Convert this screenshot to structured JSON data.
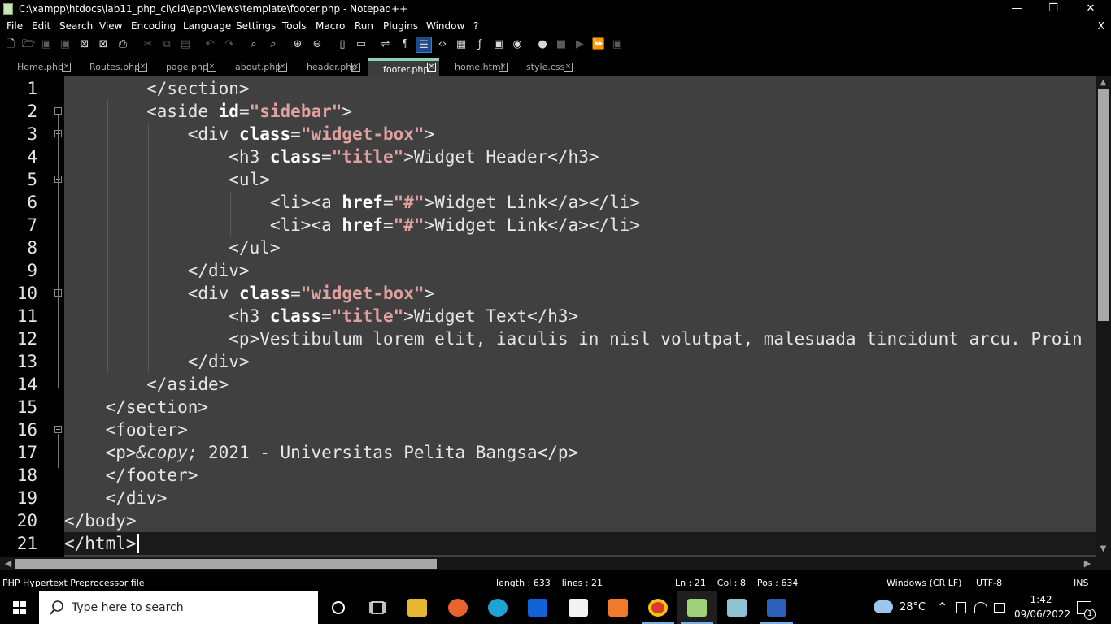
{
  "window": {
    "title": "C:\\xampp\\htdocs\\lab11_php_ci\\ci4\\app\\Views\\template\\footer.php - Notepad++",
    "minimize": "—",
    "maximize": "❐",
    "close": "✕"
  },
  "menu": {
    "items": [
      "File",
      "Edit",
      "Search",
      "View",
      "Encoding",
      "Language",
      "Settings",
      "Tools",
      "Macro",
      "Run",
      "Plugins",
      "Window",
      "?"
    ],
    "close_doc": "X"
  },
  "tabs": [
    {
      "label": "Home.php",
      "active": false
    },
    {
      "label": "Routes.php",
      "active": false
    },
    {
      "label": "page.php",
      "active": false
    },
    {
      "label": "about.php",
      "active": false
    },
    {
      "label": "header.php",
      "active": false
    },
    {
      "label": "footer.php",
      "active": true
    },
    {
      "label": "home.html",
      "active": false
    },
    {
      "label": "style.css",
      "active": false
    }
  ],
  "tab_close_glyph": "×",
  "editor": {
    "line_numbers": [
      "1",
      "2",
      "3",
      "4",
      "5",
      "6",
      "7",
      "8",
      "9",
      "10",
      "11",
      "12",
      "13",
      "14",
      "15",
      "16",
      "17",
      "18",
      "19",
      "20",
      "21"
    ],
    "current_line": 21,
    "lines": [
      [
        {
          "t": "        </section>"
        }
      ],
      [
        {
          "t": "        <aside "
        },
        {
          "t": "id",
          "c": "kw"
        },
        {
          "t": "="
        },
        {
          "t": "\"sidebar\"",
          "c": "str"
        },
        {
          "t": ">"
        }
      ],
      [
        {
          "t": "            <div "
        },
        {
          "t": "class",
          "c": "kw"
        },
        {
          "t": "="
        },
        {
          "t": "\"widget-box\"",
          "c": "str"
        },
        {
          "t": ">"
        }
      ],
      [
        {
          "t": "                <h3 "
        },
        {
          "t": "class",
          "c": "kw"
        },
        {
          "t": "="
        },
        {
          "t": "\"title\"",
          "c": "str"
        },
        {
          "t": ">Widget Header</h3>"
        }
      ],
      [
        {
          "t": "                <ul>"
        }
      ],
      [
        {
          "t": "                    <li><a "
        },
        {
          "t": "href",
          "c": "kw"
        },
        {
          "t": "="
        },
        {
          "t": "\"#\"",
          "c": "str"
        },
        {
          "t": ">Widget Link</a></li>"
        }
      ],
      [
        {
          "t": "                    <li><a "
        },
        {
          "t": "href",
          "c": "kw"
        },
        {
          "t": "="
        },
        {
          "t": "\"#\"",
          "c": "str"
        },
        {
          "t": ">Widget Link</a></li>"
        }
      ],
      [
        {
          "t": "                </ul>"
        }
      ],
      [
        {
          "t": "            </div>"
        }
      ],
      [
        {
          "t": "            <div "
        },
        {
          "t": "class",
          "c": "kw"
        },
        {
          "t": "="
        },
        {
          "t": "\"widget-box\"",
          "c": "str"
        },
        {
          "t": ">"
        }
      ],
      [
        {
          "t": "                <h3 "
        },
        {
          "t": "class",
          "c": "kw"
        },
        {
          "t": "="
        },
        {
          "t": "\"title\"",
          "c": "str"
        },
        {
          "t": ">Widget Text</h3>"
        }
      ],
      [
        {
          "t": "                <p>Vestibulum lorem elit, iaculis in nisl volutpat, malesuada tincidunt arcu. Proin"
        }
      ],
      [
        {
          "t": "            </div>"
        }
      ],
      [
        {
          "t": "        </aside>"
        }
      ],
      [
        {
          "t": "    </section>"
        }
      ],
      [
        {
          "t": "    <footer>"
        }
      ],
      [
        {
          "t": "    <p>"
        },
        {
          "t": "&copy;",
          "c": "ent"
        },
        {
          "t": " 2021 - Universitas Pelita Bangsa</p>"
        }
      ],
      [
        {
          "t": "    </footer>"
        }
      ],
      [
        {
          "t": "    </div>"
        }
      ],
      [
        {
          "t": "</body>"
        }
      ],
      [
        {
          "t": "</html>"
        }
      ]
    ],
    "fold_markers": [
      2,
      3,
      5,
      10,
      16
    ]
  },
  "scroll": {
    "up": "▲",
    "down": "▼",
    "left": "◀",
    "right": "▶"
  },
  "status": {
    "file_type": "PHP Hypertext Preprocessor file",
    "length": "length : 633    lines : 21",
    "position": "Ln : 21    Col : 8    Pos : 634",
    "eol": "Windows (CR LF)",
    "encoding": "UTF-8",
    "mode": "INS"
  },
  "taskbar": {
    "search_placeholder": "Type here to search",
    "temperature": "28°C",
    "time": "1:42",
    "date": "09/06/2022",
    "notification_count": "1",
    "chevron": "⌃"
  },
  "colors": {
    "editor_bg": "#404040",
    "current_line": "#1a1a1a",
    "attr": "#ffffff",
    "string": "#e0a0a0",
    "active_tab_accent": "#8fd2b6"
  }
}
